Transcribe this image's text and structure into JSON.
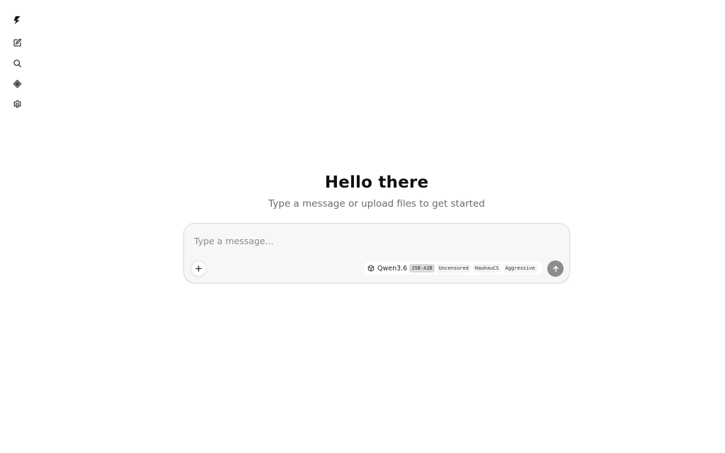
{
  "sidebar": {
    "items": [
      {
        "icon": "logo-bolt-icon"
      },
      {
        "icon": "new-chat-icon"
      },
      {
        "icon": "search-icon"
      },
      {
        "icon": "models-icon"
      },
      {
        "icon": "settings-icon"
      }
    ]
  },
  "hero": {
    "title": "Hello there",
    "subtitle": "Type a message or upload files to get started"
  },
  "composer": {
    "placeholder": "Type a message...",
    "attach_label": "+",
    "model": {
      "name": "Qwen3.6",
      "tags": [
        "35B-A3B",
        "Uncensored",
        "HauhauCS",
        "Aggressive"
      ]
    }
  },
  "colors": {
    "send_button": "#8c8c8c",
    "composer_bg": "#f7f7f7",
    "subtitle": "#6b6b6b"
  }
}
